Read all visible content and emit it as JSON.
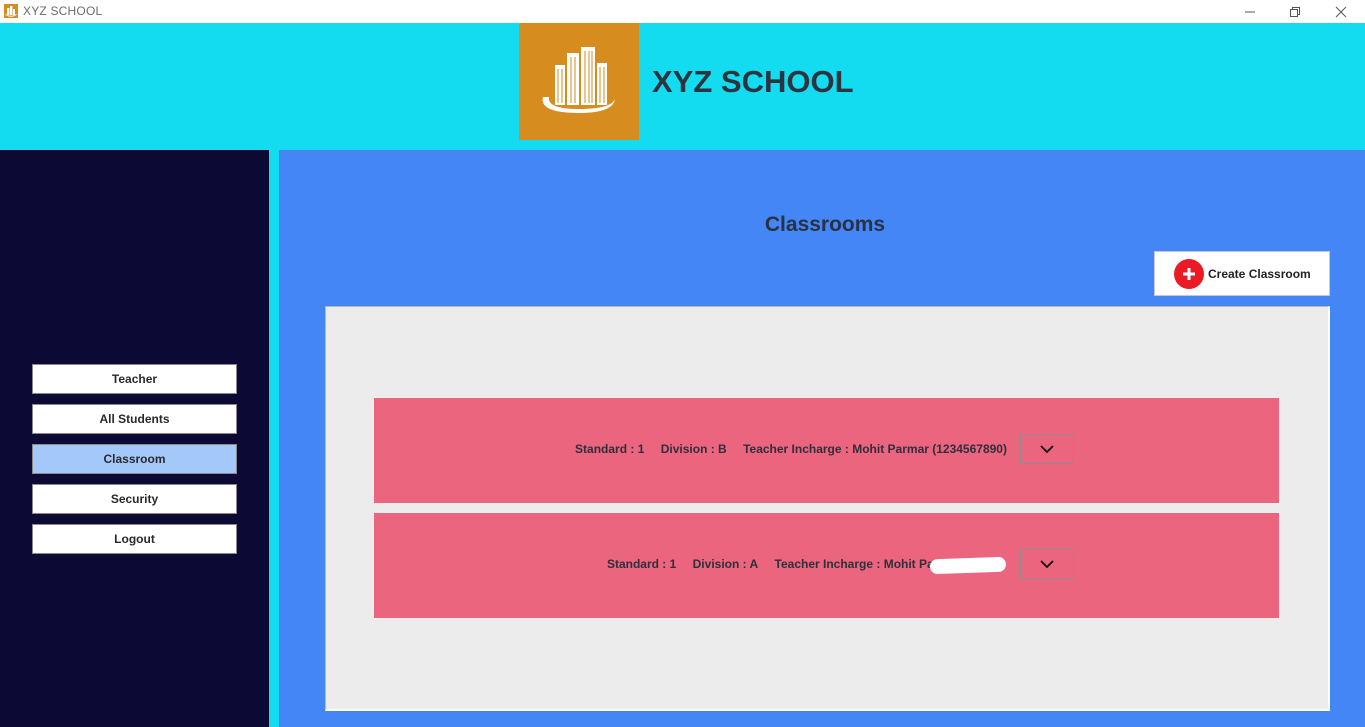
{
  "window": {
    "title": "XYZ SCHOOL",
    "controls": [
      "minimize",
      "restore",
      "close"
    ]
  },
  "header": {
    "school_name": "XYZ SCHOOL",
    "logo_icon": "building-logo-icon",
    "bg_color": "#13dcf0",
    "logo_bg_color": "#d68c1e"
  },
  "sidebar": {
    "items": [
      {
        "label": "Teacher",
        "active": false
      },
      {
        "label": "All Students",
        "active": false
      },
      {
        "label": "Classroom",
        "active": true
      },
      {
        "label": "Security",
        "active": false
      },
      {
        "label": "Logout",
        "active": false
      }
    ],
    "bg_color": "#0c0935",
    "active_color": "#a5c8fb"
  },
  "main": {
    "title": "Classrooms",
    "create_button": {
      "label": "Create Classroom",
      "icon": "plus-circle-icon"
    },
    "bg_color": "#4486f6",
    "classrooms": [
      {
        "standard": "Standard : 1",
        "division": "Division : B",
        "teacher": "Teacher Incharge : Mohit Parmar (1234567890)",
        "redacted": false
      },
      {
        "standard": "Standard : 1",
        "division": "Division : A",
        "teacher": "Teacher Incharge : Mohit Parmar (          )",
        "redacted": true
      }
    ],
    "card_color": "#ea657d"
  }
}
